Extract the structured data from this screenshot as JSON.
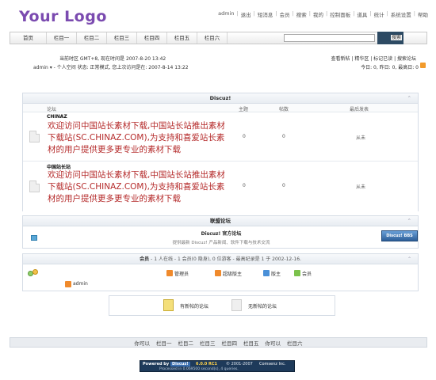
{
  "logo": "Your Logo",
  "top_links": [
    "admin",
    "退出",
    "短消息",
    "会员",
    "搜索",
    "我的",
    "控制面板",
    "道具",
    "统计",
    "系统设置",
    "帮助"
  ],
  "nav": [
    "首页",
    "栏目一",
    "栏目二",
    "栏目三",
    "栏目四",
    "栏目五",
    "栏目六"
  ],
  "search_button": "搜索",
  "time_info": "当前时区 GMT+8, 现在时间是 2007-8-20 13:42",
  "user_info": "admin ▾ - 个人空间 状态: 正常模式, 您上次访问是在: 2007-8-14 13:22",
  "right_links1": "查看新帖 | 精华区 | 标记已读 | 搜索论坛",
  "right_links2": "今日: 0, 昨日: 0, 最高日: 0",
  "section_title": "Discuz!",
  "columns": {
    "forum": "论坛",
    "topics": "主题",
    "posts": "帖数",
    "last_post": "最后发表"
  },
  "forums": [
    {
      "name": "CHINAZ",
      "desc": "欢迎访问中国站长素材下载,中国站长站推出素材下载站(SC.CHINAZ.COM),为支持和喜爱站长素材的用户提供更多更专业的素材下载",
      "topics": "0",
      "posts": "0",
      "last": "从未"
    },
    {
      "name": "中国站长站",
      "desc": "欢迎访问中国站长素材下载,中国站长站推出素材下载站(SC.CHINAZ.COM),为支持和喜爱站长素材的用户提供更多更专业的素材下载",
      "topics": "0",
      "posts": "0",
      "last": "从未"
    }
  ],
  "links_title": "联盟论坛",
  "link_site": {
    "name": "Discuz! 官方论坛",
    "desc": "提供最新 Discuz! 产品新闻、软件下载与技术交流",
    "logo_text": "Discuz! BBS"
  },
  "members_bar": {
    "title": "会员",
    "text": "- 1 人在线 - 1 会员(0 隐身), 0 位游客 - 最高纪录是 1 于 2002-12-16."
  },
  "roles": [
    "管理员",
    "超级版主",
    "版主",
    "会员"
  ],
  "online_user": "admin",
  "legend": {
    "new": "有新帖的论坛",
    "nonew": "无新帖的论坛"
  },
  "footer_nav": [
    "你可以",
    "栏目一",
    "栏目二",
    "栏目三",
    "栏目四",
    "栏目五",
    "你可以",
    "栏目六"
  ],
  "powered": {
    "label": "Powered by",
    "product": "Discuz!",
    "version": "6.0.0 RC1",
    "years": "© 2001-2007",
    "company": "Comsenz Inc.",
    "processed": "Processed in 0.069500 second(s), 4 queries."
  },
  "colors": {
    "logo": "#7b4bb0",
    "desc": "#b52b2b",
    "nav_bar": "#e9ecf0"
  }
}
